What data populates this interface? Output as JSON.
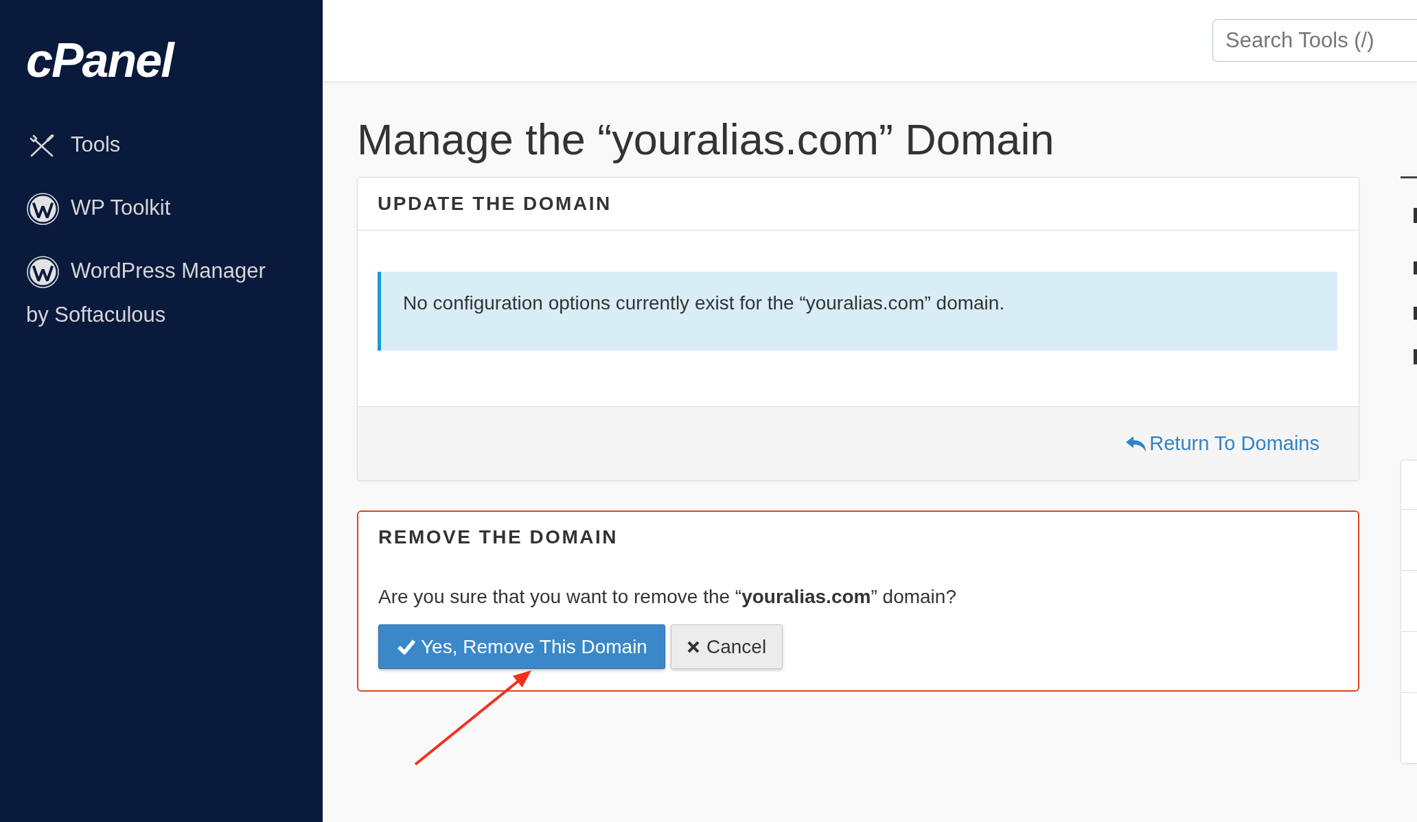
{
  "sidebar": {
    "logo": "cPanel",
    "items": [
      {
        "label": "Tools",
        "kind": "tools"
      },
      {
        "label": "WP Toolkit",
        "kind": "plugin"
      },
      {
        "label": "WordPress Manager by Softaculous",
        "kind": "plugin"
      }
    ]
  },
  "header": {
    "search": {
      "placeholder": "Search Tools (/)"
    }
  },
  "page_title": "Manage the “youralias.com” Domain",
  "update_panel": {
    "title": "UPDATE THE DOMAIN",
    "alert": "No configuration options currently exist for the “youralias.com” domain.",
    "footer_link": "Return To Domains"
  },
  "remove_panel": {
    "title": "REMOVE THE DOMAIN",
    "question": "Are you sure that you want to remove the “**youralias.com**” domain?",
    "buttons": [
      {
        "label": "Yes, Remove This Domain",
        "kind": "primary"
      },
      {
        "label": "Cancel",
        "kind": "secondary"
      }
    ]
  }
}
